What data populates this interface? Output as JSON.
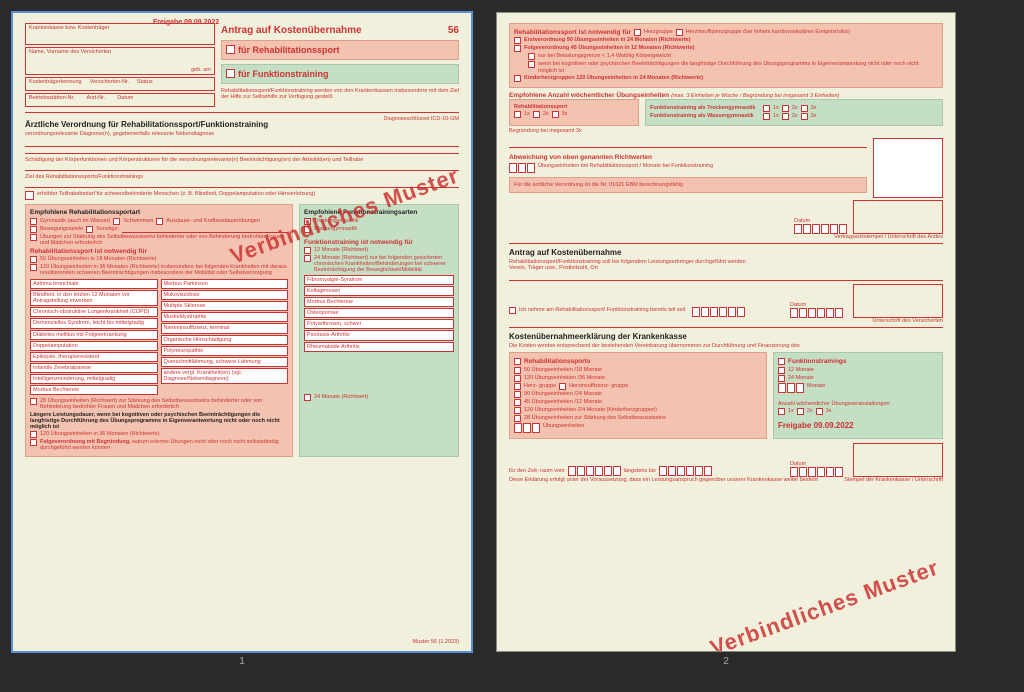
{
  "meta": {
    "freigabe": "Freigabe 09.09.2022",
    "watermark": "Verbindliches Muster",
    "form_number": "56",
    "muster_footnote": "Muster 56 (1.2023)"
  },
  "page1": {
    "header": {
      "krankenkasse": "Krankenkasse bzw. Kostenträger",
      "name": "Name, Vorname des Versicherten",
      "geb": "geb. am",
      "kosten_kenn": "Kostenträgerkennung",
      "vers_nr": "Versicherten-Nr.",
      "status": "Status",
      "betriebs": "Betriebsstätten-Nr.",
      "arzt_nr": "Arzt-Nr.",
      "datum": "Datum",
      "title_main": "Antrag auf Kostenübernahme",
      "reha": "für Rehabilitationssport",
      "funk": "für Funktionstraining",
      "subtext": "Rehabilitationssport/Funktionstraining werden von den Krankenkassen insbesondere mit dem Ziel der Hilfe zur Selbsthilfe zur Verfügung gestellt."
    },
    "verordnung": {
      "title": "Ärztliche Verordnung für Rehabilitationssport/Funktionstraining",
      "sub": "verordnungsrelevante Diagnose(n), gegebenenfalls relevante Nebendiagnose",
      "icd_label": "Diagnoseschlüssel ICD-10-GM",
      "schaedigung": "Schädigung der Körperfunktionen und Körperstrukturen für die verordnungsrelevante(n) Beeinträchtigung(en) der Aktivität(en) und Teilhabe",
      "ziel": "Ziel des Rehabilitationssports/Funktionstrainings",
      "teilhabe": "erhöhter Teilhabebedarf für schwerstbehinderte Menschen (z. B. Blindheit, Doppelamputation oder Hirnverletzung)"
    },
    "reha_box": {
      "title": "Empfohlene Rehabilitationssportart",
      "opts1": [
        "Gymnastik (auch im Wasser)",
        "Schwimmen",
        "Ausdauer- und Kraftausdauerübungen"
      ],
      "opts2_a": "Bewegungsspiele",
      "opts2_b": "Sonstige:",
      "opts3": "Übungen zur Stärkung des Selbstbewusstseins behinderter oder von Behinderung bedrohter Frauen und Mädchen erforderlich",
      "notwendig": "Rehabilitationssport ist notwendig für",
      "dur1": "50 Übungseinheiten in 18 Monaten (Richtwerte)",
      "dur2": "120 Übungseinheiten in 36 Monaten (Richtwerte) insbesondere bei folgenden Krankheiten mit daraus resultierenden schweren Beeinträchtigungen insbesondere der Mobilität oder Selbstversorgung",
      "conditions_left": [
        "Asthma bronchiale",
        "Blindheit, in den letzten 12 Monaten vor Antragstellung erworben",
        "Chronisch-obstruktive Lungenkrankheit (COPD)",
        "Demenzielles Syndrom, leicht bis mittelgradig",
        "Diabetes mellitus mit Folgeerkrankung",
        "Doppelamputation",
        "Epilepsie, therapieresistent",
        "Infantile Zerebralparese",
        "Intelligenzminderung, mittelgradig",
        "Morbus Bechterew"
      ],
      "conditions_right": [
        "Morbus Parkinson",
        "Mukoviszidose",
        "Multiple Sklerose",
        "Muskeldystrophie",
        "Niereninsuffizienz, terminal",
        "Organische Hirnschädigung",
        "Polyneuropathie",
        "Querschnittlähmung, schwere Lähmung",
        "andere vergl. Krankheit(en) (vgl. Diagnose/Nebendiagnose)"
      ],
      "post1": "28 Übungseinheiten (Richtwert) zur Stärkung des Selbstbewusstseins behinderter oder von Behinderung bedrohter Frauen und Mädchen erforderlich",
      "langer": "Längere Leistungsdauer, wenn bei kognitiven oder psychischen Beeinträchtigungen die langfristige Durchführung des Übungsprogramms in Eigenverantwortung nicht oder noch nicht möglich ist",
      "post2": "120 Übungseinheiten in 36 Monaten (Richtwerte)",
      "folge": "Folgeverordnung mit Begründung,",
      "folge_sub": "warum erlernte Übungen nicht oder noch nicht selbstständig durchgeführt werden können"
    },
    "funk_box": {
      "title": "Empfohlene Funktionstrainingsarten",
      "t1": "Trockengymnastik",
      "t2": "Wassergymnastik",
      "notwendig": "Funktionstraining ist notwendig für",
      "d1": "12 Monate (Richtwert)",
      "d2": "24 Monate (Richtwert) nur bei folgenden gesicherten chronischen Krankheiten/Behinderungen bei schwerer Beeinträchtigung der Beweglichkeit/Mobilität",
      "conditions": [
        "Fibromyalgie-Syndrom",
        "Kollagenosen",
        "Morbus Bechterew",
        "Osteoporose",
        "Polyarthrosen, schwer",
        "Psoriasis-Arthritis",
        "Rheumatoide Arthritis"
      ],
      "d3": "24 Monate (Richtwert)"
    }
  },
  "page2": {
    "top": {
      "notwendig": "Rehabilitationssport ist notwendig für",
      "herz": "Herzgruppe",
      "herzinsuff": "Herzinsuffizienzgruppe (bei hohem kardiovaskulären Ereignisrisiko)",
      "erst": "Erstverordnung 90 Übungseinheiten in 24 Monaten (Richtwerte)",
      "folge": "Folgeverordnung 45 Übungseinheiten in 12 Monaten (Richtwerte)",
      "f1": "nur bei Belastungsgrenze < 1,4 Watt/kg Körpergewicht",
      "f2": "wenn bei kognitiven oder psychischen Beeinträchtigungen die langfristige Durchführung des Übungsprogramms in Eigenverantwortung nicht oder noch nicht möglich ist",
      "kinder": "Kinderherzgruppen 120 Übungseinheiten in 24 Monaten (Richtwerte)"
    },
    "empf": {
      "title": "Empfohlene Anzahl wöchentlicher Übungseinheiten",
      "note": "(max. 3 Einheiten je Woche / Begründung bei insgesamt 3 Einheiten)",
      "reha": "Rehabilitationssport",
      "ft_trocken": "Funktionstraining als Trockengymnastik",
      "ft_wasser": "Funktionstraining als Wassergymnastik",
      "x1": "1x",
      "x2": "2x",
      "x3": "3x",
      "begr3x": "Begründung bei insgesamt 3x"
    },
    "abweich": {
      "title": "Abweichung von oben genannten Richtwerten",
      "line": "Übungseinheiten bei Rehabilitationssport / Monate bei Funktionstraining",
      "ebm": "Für die ärztliche Verordnung ist die Nr. 01621 EBM berechnungsfähig",
      "datum": "Datum",
      "sig": "Vertragsarztstempel / Unterschrift des Arztes"
    },
    "antrag": {
      "title": "Antrag auf Kostenübernahme",
      "sub": "Rehabilitationssport/Funktionstraining soll bei folgendem Leistungserbringer durchgeführt werden",
      "sub2": "Verein, Träger usw., Postleitzahl, Ort",
      "teil": "Ich nehme am Rehabilitationssport/ Funktionstraining bereits teil seit",
      "datum": "Datum",
      "sig": "Unterschrift des Versicherten"
    },
    "kk": {
      "title": "Kostenübernahmeerklärung der Krankenkasse",
      "sub": "Die Kosten werden entsprechend der bestehenden Vereinbarung übernommen zur Durchführung und Finanzierung des",
      "reha_head": "Rehabilitationssports",
      "funk_head": "Funktionstrainings",
      "r1": "50 Übungseinheiten /18 Monate",
      "r2": "120 Übungseinheiten /36 Monate",
      "r3a": "Herz- gruppe",
      "r3b": "Herzinsuffizienz- gruppe",
      "r4": "90 Übungseinheiten /24 Monate",
      "r5": "45 Übungseinheiten /12 Monate",
      "r6": "120 Übungseinheiten /24 Monate (Kinderherzgruppen)",
      "r7": "28 Übungseinheiten zur Stärkung des Selbstbewusstseins",
      "r8": "Übungseinheiten",
      "f1": "12 Monate",
      "f2": "24 Monate",
      "f3": "Monate",
      "anz": "Anzahl wöchentlicher Übungsveranstaltungen",
      "zeit_a": "für den Zeit- raum vom",
      "zeit_b": "längstens bis",
      "foot": "Diese Erklärung erfolgt unter der Voraussetzung, dass ein Leistungsanspruch gegenüber unserer Krankenkasse weiter besteht",
      "datum": "Datum",
      "sig": "Stempel der Krankenkasse / Unterschrift"
    }
  },
  "pages": {
    "p1": "1",
    "p2": "2"
  }
}
